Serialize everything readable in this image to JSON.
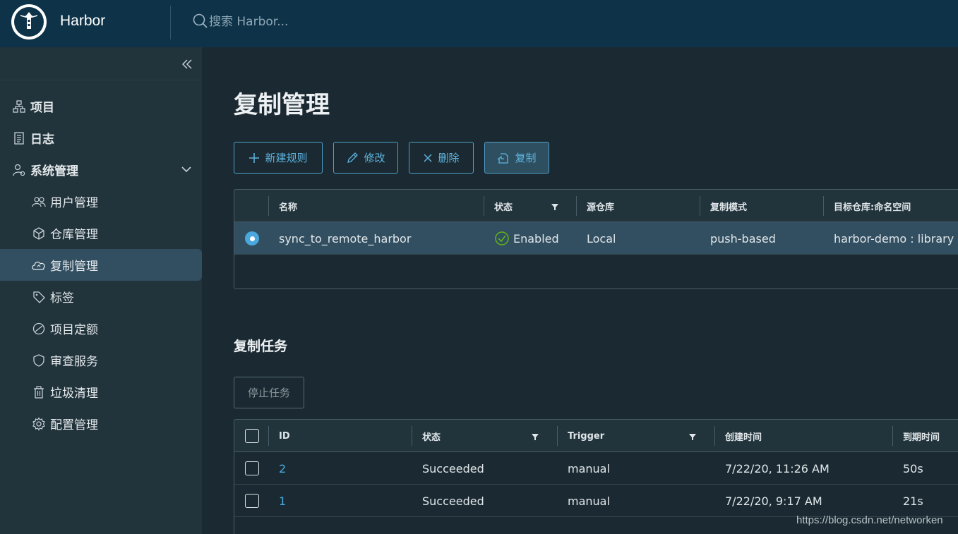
{
  "header": {
    "brand": "Harbor",
    "search_placeholder": "搜索 Harbor..."
  },
  "sidebar": {
    "items": [
      {
        "label": "项目",
        "icon": "project-icon"
      },
      {
        "label": "日志",
        "icon": "log-icon"
      },
      {
        "label": "系统管理",
        "icon": "admin-icon"
      },
      {
        "label": "用户管理",
        "icon": "users-icon"
      },
      {
        "label": "仓库管理",
        "icon": "registry-icon"
      },
      {
        "label": "复制管理",
        "icon": "cloud-icon"
      },
      {
        "label": "标签",
        "icon": "tag-icon"
      },
      {
        "label": "项目定额",
        "icon": "quota-icon"
      },
      {
        "label": "审查服务",
        "icon": "shield-icon"
      },
      {
        "label": "垃圾清理",
        "icon": "trash-icon"
      },
      {
        "label": "配置管理",
        "icon": "gear-icon"
      }
    ]
  },
  "main": {
    "title": "复制管理",
    "toolbar": {
      "new_rule": "新建规则",
      "edit": "修改",
      "delete": "删除",
      "replicate": "复制"
    },
    "rules_table": {
      "headers": [
        "名称",
        "状态",
        "源仓库",
        "复制模式",
        "目标仓库:命名空间"
      ],
      "rows": [
        {
          "name": "sync_to_remote_harbor",
          "status": "Enabled",
          "source": "Local",
          "mode": "push-based",
          "target": "harbor-demo : library"
        }
      ]
    },
    "tasks_title": "复制任务",
    "stop_task": "停止任务",
    "tasks_table": {
      "headers": [
        "ID",
        "状态",
        "Trigger",
        "创建时间",
        "到期时间"
      ],
      "rows": [
        {
          "id": "2",
          "status": "Succeeded",
          "trigger": "manual",
          "created": "7/22/20, 11:26 AM",
          "duration": "50s"
        },
        {
          "id": "1",
          "status": "Succeeded",
          "trigger": "manual",
          "created": "7/22/20, 9:17 AM",
          "duration": "21s"
        }
      ]
    }
  },
  "watermark": "https://blog.csdn.net/networken",
  "colors": {
    "header_bg": "#0e3349",
    "sidebar_bg": "#21333b",
    "content_bg": "#1b2a32",
    "accent": "#4aa8de",
    "active_nav": "#324f61",
    "success": "#60b515"
  }
}
